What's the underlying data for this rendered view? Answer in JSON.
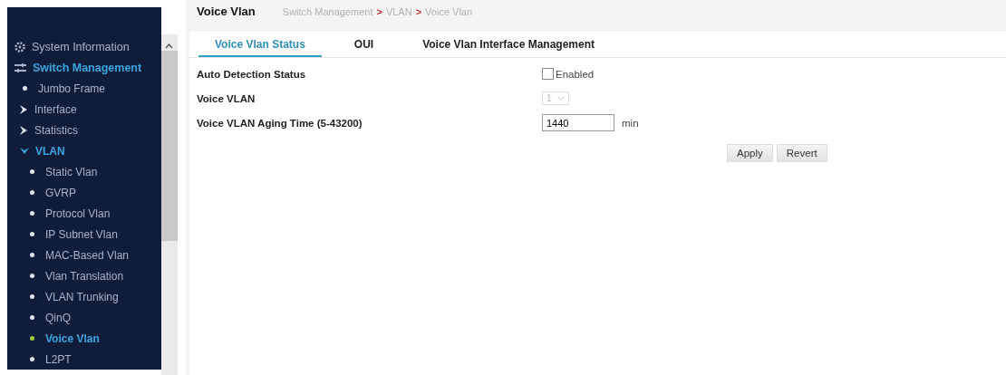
{
  "sidebar": {
    "items": [
      {
        "label": "System Information",
        "kind": "section",
        "selected": false
      },
      {
        "label": "Switch Management",
        "kind": "section",
        "selected": true,
        "children": [
          {
            "label": "Jumbo Frame",
            "kind": "leaf",
            "selected": false
          },
          {
            "label": "Interface",
            "kind": "group",
            "expanded": false,
            "selected": false
          },
          {
            "label": "Statistics",
            "kind": "group",
            "expanded": false,
            "selected": false
          },
          {
            "label": "VLAN",
            "kind": "group",
            "expanded": true,
            "selected": true,
            "children": [
              {
                "label": "Static Vlan",
                "kind": "leaf",
                "selected": false
              },
              {
                "label": "GVRP",
                "kind": "leaf",
                "selected": false
              },
              {
                "label": "Protocol Vlan",
                "kind": "leaf",
                "selected": false
              },
              {
                "label": "IP Subnet Vlan",
                "kind": "leaf",
                "selected": false
              },
              {
                "label": "MAC-Based Vlan",
                "kind": "leaf",
                "selected": false
              },
              {
                "label": "Vlan Translation",
                "kind": "leaf",
                "selected": false
              },
              {
                "label": "VLAN Trunking",
                "kind": "leaf",
                "selected": false
              },
              {
                "label": "QinQ",
                "kind": "leaf",
                "selected": false
              },
              {
                "label": "Voice Vlan",
                "kind": "leaf",
                "selected": true
              },
              {
                "label": "L2PT",
                "kind": "leaf",
                "selected": false
              }
            ]
          }
        ]
      }
    ]
  },
  "header": {
    "title": "Voice Vlan",
    "breadcrumb": [
      "Switch Management",
      "VLAN",
      "Voice Vlan"
    ],
    "separator": ">"
  },
  "tabs": [
    {
      "label": "Voice Vlan Status",
      "selected": true
    },
    {
      "label": "OUI",
      "selected": false
    },
    {
      "label": "Voice Vlan Interface Management",
      "selected": false
    }
  ],
  "form": {
    "rows": [
      {
        "label": "Auto Detection Status",
        "kind": "checkbox",
        "text": "Enabled",
        "checked": false
      },
      {
        "label": "Voice VLAN",
        "kind": "select",
        "value": "1",
        "disabled": true
      },
      {
        "label": "Voice VLAN Aging Time (5-43200)",
        "kind": "input",
        "value": "1440",
        "unit": "min"
      }
    ]
  },
  "buttons": [
    "Apply",
    "Revert"
  ]
}
